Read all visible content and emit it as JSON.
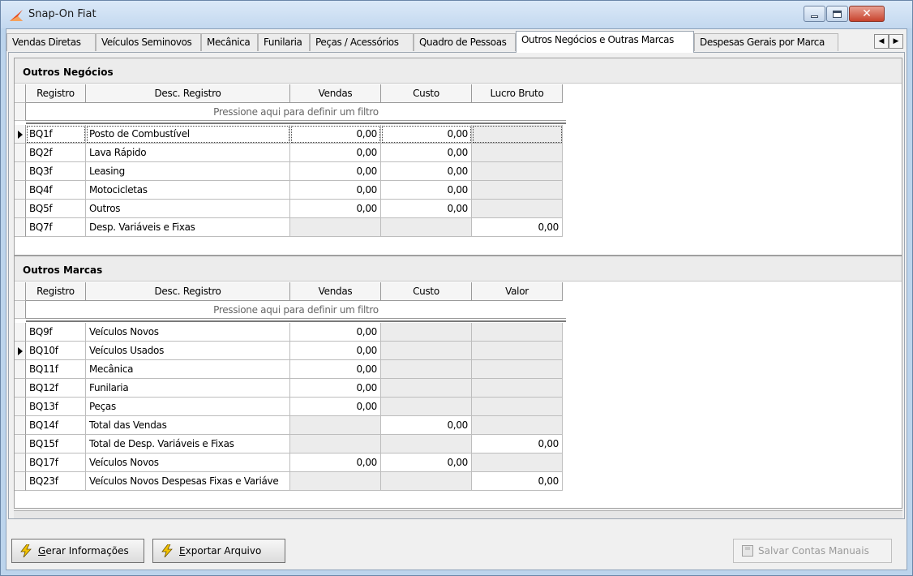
{
  "window": {
    "title": "Snap-On Fiat"
  },
  "tabs": [
    "Vendas Diretas",
    "Veículos Seminovos",
    "Mecânica",
    "Funilaria",
    "Peças / Acessórios",
    "Quadro de Pessoas",
    "Outros Negócios e Outras Marcas",
    "Despesas Gerais por Marca"
  ],
  "active_tab": "Outros Negócios e Outras Marcas",
  "filter_hint": "Pressione aqui para definir um filtro",
  "outros_negocios": {
    "title": "Outros Negócios",
    "columns": [
      "Registro",
      "Desc. Registro",
      "Vendas",
      "Custo",
      "Lucro Bruto"
    ],
    "rows": [
      {
        "registro": "BQ1f",
        "desc": "Posto de Combustível",
        "vendas": "0,00",
        "custo": "0,00",
        "lucro": ""
      },
      {
        "registro": "BQ2f",
        "desc": "Lava Rápido",
        "vendas": "0,00",
        "custo": "0,00",
        "lucro": ""
      },
      {
        "registro": "BQ3f",
        "desc": "Leasing",
        "vendas": "0,00",
        "custo": "0,00",
        "lucro": ""
      },
      {
        "registro": "BQ4f",
        "desc": "Motocicletas",
        "vendas": "0,00",
        "custo": "0,00",
        "lucro": ""
      },
      {
        "registro": "BQ5f",
        "desc": "Outros",
        "vendas": "0,00",
        "custo": "0,00",
        "lucro": ""
      },
      {
        "registro": "BQ7f",
        "desc": "Desp. Variáveis e Fixas",
        "vendas": "",
        "custo": "",
        "lucro": "0,00"
      }
    ]
  },
  "outros_marcas": {
    "title": "Outros Marcas",
    "columns": [
      "Registro",
      "Desc. Registro",
      "Vendas",
      "Custo",
      "Valor"
    ],
    "rows": [
      {
        "registro": "BQ9f",
        "desc": "Veículos Novos",
        "vendas": "0,00",
        "custo": "",
        "valor": ""
      },
      {
        "registro": "BQ10f",
        "desc": "Veículos Usados",
        "vendas": "0,00",
        "custo": "",
        "valor": ""
      },
      {
        "registro": "BQ11f",
        "desc": "Mecânica",
        "vendas": "0,00",
        "custo": "",
        "valor": ""
      },
      {
        "registro": "BQ12f",
        "desc": "Funilaria",
        "vendas": "0,00",
        "custo": "",
        "valor": ""
      },
      {
        "registro": "BQ13f",
        "desc": "Peças",
        "vendas": "0,00",
        "custo": "",
        "valor": ""
      },
      {
        "registro": "BQ14f",
        "desc": "Total das Vendas",
        "vendas": "",
        "custo": "0,00",
        "valor": ""
      },
      {
        "registro": "BQ15f",
        "desc": "Total de Desp. Variáveis e Fixas",
        "vendas": "",
        "custo": "",
        "valor": "0,00"
      },
      {
        "registro": "BQ17f",
        "desc": "Veículos Novos",
        "vendas": "0,00",
        "custo": "0,00",
        "valor": ""
      },
      {
        "registro": "BQ23f",
        "desc": "Veículos Novos Despesas Fixas e Variáve",
        "vendas": "",
        "custo": "",
        "valor": "0,00"
      }
    ]
  },
  "buttons": {
    "gerar": {
      "underline": "G",
      "rest": "erar Informações"
    },
    "exportar": {
      "underline": "E",
      "rest": "xportar Arquivo"
    },
    "salvar": "Salvar Contas Manuais"
  },
  "colors": {
    "accent_bolt": "#f2c200",
    "readonly_cell": "#ececec",
    "titlebar": "#c3d8ef"
  }
}
